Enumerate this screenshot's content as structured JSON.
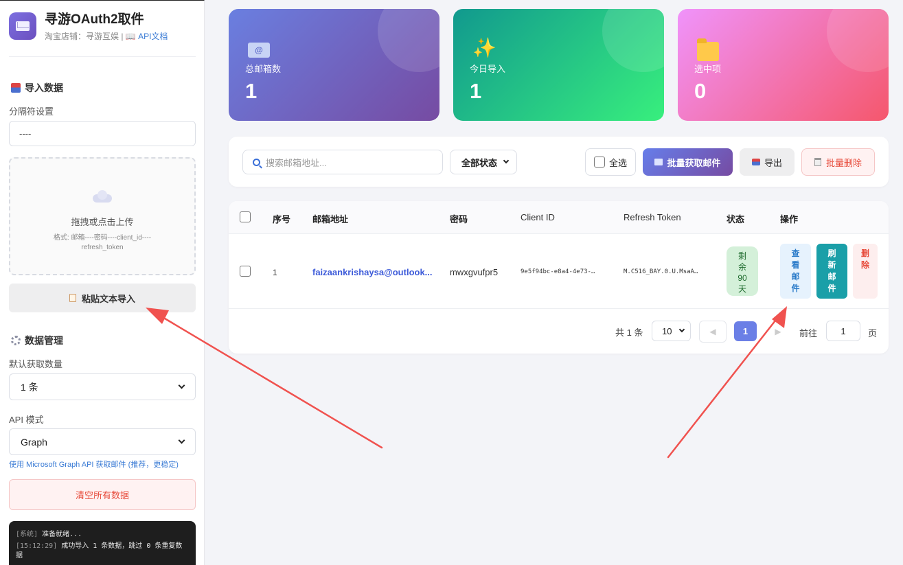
{
  "brand": {
    "title": "寻游OAuth2取件",
    "shop": "淘宝店铺：寻游互娱 |",
    "api_doc": "📖 API文档"
  },
  "import": {
    "title": "导入数据",
    "separator_label": "分隔符设置",
    "separator_value": "----",
    "drop_title": "拖拽或点击上传",
    "drop_hint": "格式: 邮箱----密码----client_id----refresh_token",
    "paste_button": "粘贴文本导入"
  },
  "manage": {
    "title": "数据管理",
    "fetch_label": "默认获取数量",
    "fetch_value": "1 条",
    "api_label": "API 模式",
    "api_value": "Graph",
    "api_hint": "使用 Microsoft Graph API 获取邮件 (推荐，更稳定)",
    "clear_button": "清空所有数据"
  },
  "log": [
    {
      "ts": "[系统]",
      "msg": "准备就绪..."
    },
    {
      "ts": "[15:12:29]",
      "msg": "成功导入 1 条数据，跳过 0 条重复数据"
    }
  ],
  "stats": [
    {
      "label": "总邮箱数",
      "value": "1",
      "icon": "envelope-icon"
    },
    {
      "label": "今日导入",
      "value": "1",
      "icon": "sparkles-icon"
    },
    {
      "label": "选中项",
      "value": "0",
      "icon": "folder-icon"
    }
  ],
  "toolbar": {
    "search_placeholder": "搜索邮箱地址...",
    "status_filter": "全部状态",
    "select_all": "全选",
    "batch_fetch": "批量获取邮件",
    "export": "导出",
    "batch_delete": "批量删除"
  },
  "table": {
    "headers": [
      "序号",
      "邮箱地址",
      "密码",
      "Client ID",
      "Refresh Token",
      "状态",
      "操作"
    ],
    "rows": [
      {
        "index": "1",
        "email": "faizaankrishaysa@outlook...",
        "password": "mwxgvufpr5",
        "client_id": "9e5f94bc-e8a4-4e73-…",
        "refresh_token": "M.C516_BAY.0.U.MsaA…",
        "status": "剩余90天",
        "actions": {
          "view": "查看邮件",
          "refresh": "刷新邮件",
          "delete": "删除"
        }
      }
    ]
  },
  "pagination": {
    "total": "共 1 条",
    "page_size": "10",
    "current": "1",
    "goto_label": "前往",
    "goto_value": "1",
    "page_unit": "页"
  },
  "colors": {
    "accent": "#667eea",
    "annotation_arrow": "#f0524f"
  }
}
